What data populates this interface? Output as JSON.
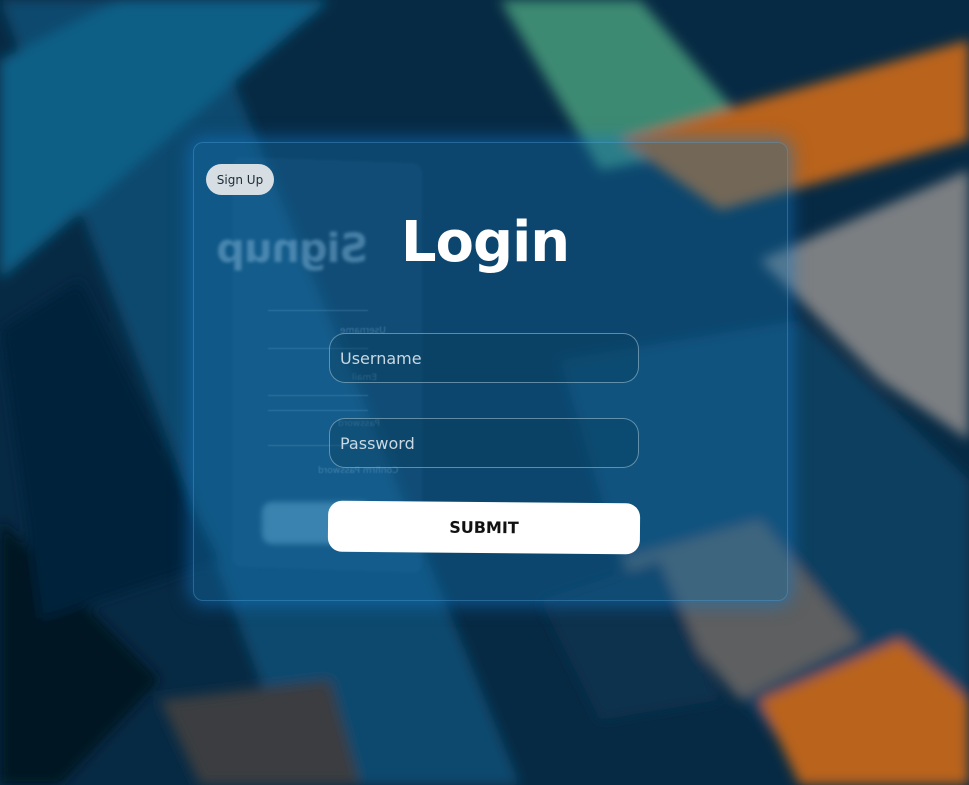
{
  "signup_button_label": "Sign Up",
  "login_title": "Login",
  "username": {
    "placeholder": "Username",
    "value": ""
  },
  "password": {
    "placeholder": "Password",
    "value": ""
  },
  "submit_label": "SUBMIT",
  "colors": {
    "background": "#062a45",
    "card": "#1a6ea8",
    "accent_orange": "#c06a1a",
    "accent_teal": "#3c8a78"
  }
}
